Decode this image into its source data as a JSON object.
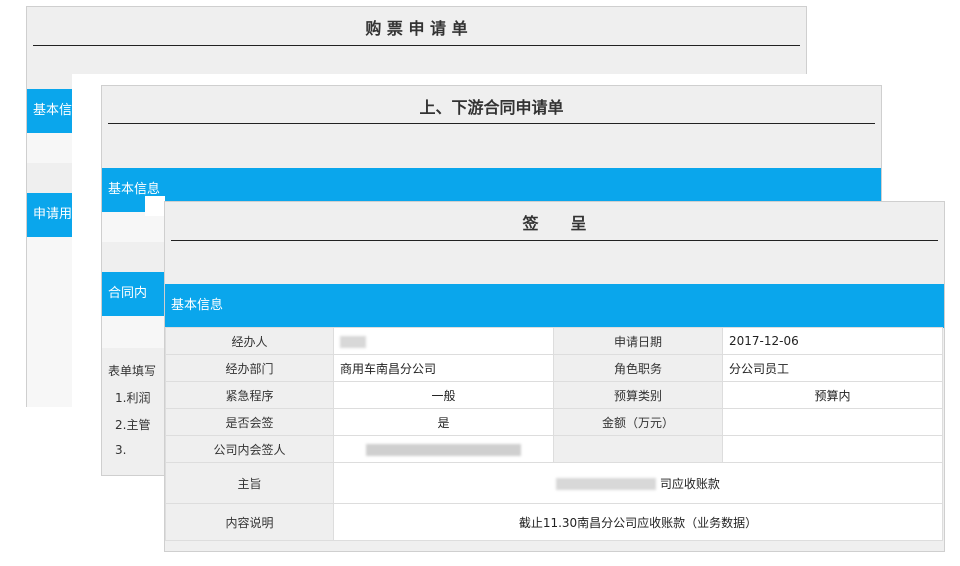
{
  "card1": {
    "title": "购 票 申 请 单",
    "sections": [
      "基本信息",
      "申请用"
    ]
  },
  "card2": {
    "title": "上、下游合同申请单",
    "sections": [
      "基本信息",
      "合同内"
    ],
    "notes_label": "表单填写",
    "notes": [
      "1.利润",
      "2.主管",
      "3."
    ]
  },
  "card3": {
    "title": "签　　呈",
    "section": "基本信息",
    "rows": [
      {
        "l1": "经办人",
        "v1": "",
        "l2": "申请日期",
        "v2": "2017-12-06"
      },
      {
        "l1": "经办部门",
        "v1": "商用车南昌分公司",
        "l2": "角色职务",
        "v2": "分公司员工"
      },
      {
        "l1": "紧急程序",
        "v1": "一般",
        "l2": "预算类别",
        "v2": "预算内"
      },
      {
        "l1": "是否会签",
        "v1": "是",
        "l2": "金额（万元）",
        "v2": ""
      },
      {
        "l1": "公司内会签人",
        "v1": "",
        "l2": "",
        "v2": ""
      }
    ],
    "subject_label": "主旨",
    "subject_value": "司应收账款",
    "content_label": "内容说明",
    "content_value": "截止11.30南昌分公司应收账款（业务数据）"
  }
}
